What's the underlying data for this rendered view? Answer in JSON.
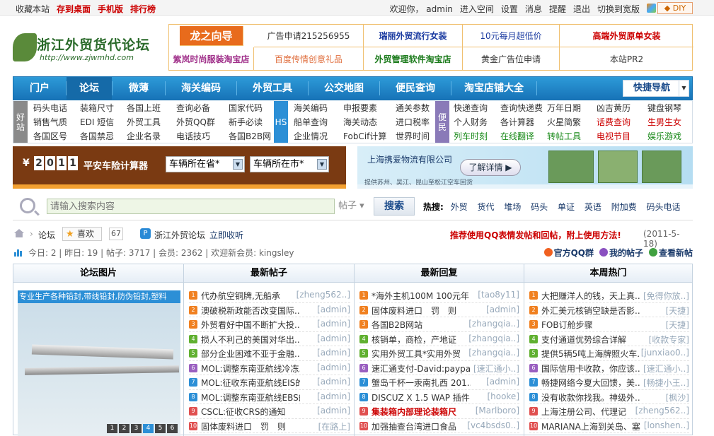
{
  "topbar": {
    "left": [
      "收藏本站",
      "存到桌面",
      "手机版",
      "排行榜"
    ],
    "greeting": "欢迎你，",
    "user": "admin",
    "right": [
      "进入空间",
      "设置",
      "消息",
      "提醒",
      "退出",
      "切换到宽版"
    ],
    "diy": "◆ DIY"
  },
  "logo": {
    "name": "浙江外贸货代论坛",
    "url": "http://www.zjwmhd.com"
  },
  "ads": [
    "龙之向导",
    "广告申请215256955",
    "瑞丽外贸流行女装",
    "10元每月超低价",
    "高端外贸原单女装",
    "紫岚时尚服装淘宝店",
    "百度传情创意礼品",
    "外贸管理软件淘宝店",
    "黄金广告位申请",
    "本站PR2"
  ],
  "nav": {
    "items": [
      "门户",
      "论坛",
      "微薄",
      "海关编码",
      "外贸工具",
      "公交地图",
      "便民查询",
      "淘宝店铺大全"
    ],
    "quick": "快捷导航"
  },
  "links": {
    "tag1": "好站",
    "tag2": "HS",
    "tag3": "便民",
    "g1": [
      [
        "码头电话",
        "销售气质",
        "各国区号"
      ],
      [
        "装箱尺寸",
        "EDI 短信",
        "各国禁忌"
      ],
      [
        "各国上班",
        "外贸工具",
        "企业名录"
      ],
      [
        "查询必备",
        "外贸QQ群",
        "电话技巧"
      ],
      [
        "国家代码",
        "新手必读",
        "各国B2B网"
      ]
    ],
    "g2": [
      [
        "海关编码",
        "船单查询",
        "企业情况"
      ],
      [
        "申报要素",
        "海关动态",
        "FobCif计算"
      ],
      [
        "通关参数",
        "进口税率",
        "世界时间"
      ]
    ],
    "g3": [
      [
        "快递查询",
        "个人财务",
        "列车时刻"
      ],
      [
        "查询快递费",
        "各计算器",
        "在线翻译"
      ],
      [
        "万年日期",
        "火星简繁",
        "转帖工具"
      ],
      [
        "凶吉黄历",
        "话费查询",
        "电视节目"
      ],
      [
        "键盘钢琴",
        "生男生女",
        "娱乐游戏"
      ]
    ]
  },
  "banner1": {
    "money": "¥",
    "digits": [
      "2",
      "0",
      "1",
      "1"
    ],
    "title": "平安车险计算器",
    "sel1": "车辆所在省*",
    "sel2": "车辆所在市*"
  },
  "banner2": {
    "company": "上海携爱物流有限公司",
    "button": "了解详情 ▶",
    "sub": "提供苏州、吴江、昆山至松江空车回货"
  },
  "search": {
    "placeholder": "请输入搜索内容",
    "type": "帖子",
    "button": "搜索",
    "hot_label": "热搜:",
    "hot": [
      "外贸",
      "货代",
      "堆场",
      "码头",
      "单证",
      "英语",
      "附加费",
      "码头电话"
    ]
  },
  "crumb": {
    "home": "论坛",
    "like": "喜欢",
    "like_count": "67",
    "forum": "浙江外贸论坛",
    "bookmark": "立即收听",
    "recommend": "推荐使用QQ表情发帖和回帖，附上使用方法!",
    "date": "(2011-5-18)"
  },
  "stats": {
    "text": "今日: 2 | 昨日: 19 | 帖子: 3717 | 会员: 2362 | 欢迎新会员: kingsley",
    "links": [
      "官方QQ群",
      "我的帖子",
      "查看新帖"
    ]
  },
  "columns": {
    "headers": [
      "论坛图片",
      "最新帖子",
      "最新回复",
      "本周热门"
    ],
    "pic_caption": "专业生产各种铅封,带线铅封,防伪铅封,塑料",
    "pager": [
      "1",
      "2",
      "3",
      "4",
      "5",
      "6"
    ],
    "latest": [
      {
        "t": "代办航空铜牌,无船承",
        "a": "[zheng562..]"
      },
      {
        "t": "澳破税新政能否改变国际..",
        "a": "[admin]"
      },
      {
        "t": "外贸看好中国不断扩大投..",
        "a": "[admin]"
      },
      {
        "t": "损人不利己的美国对华出..",
        "a": "[admin]"
      },
      {
        "t": "部分企业困难不亚于金融..",
        "a": "[admin]"
      },
      {
        "t": "MOL:调整东南亚航线冷冻..",
        "a": "[admin]"
      },
      {
        "t": "MOL:征收东南亚航线EIS的..",
        "a": "[admin]"
      },
      {
        "t": "MOL:调整东南亚航线EBS的..",
        "a": "[admin]"
      },
      {
        "t": "CSCL:征收CRS的通知",
        "a": "[admin]"
      },
      {
        "t": "固体废料进口　罚　则",
        "a": "[在路上]"
      }
    ],
    "replies": [
      {
        "t": "*海外主机100M 100元年",
        "a": "[tao8y11]"
      },
      {
        "t": "固体废料进口　罚　则",
        "a": "[admin]"
      },
      {
        "t": "各国B2B网站",
        "a": "[zhangqia..]"
      },
      {
        "t": "核销单，商检，产地证",
        "a": "[zhangqia..]"
      },
      {
        "t": "实用外贸工具*实用外贸",
        "a": "[zhangqia..]"
      },
      {
        "t": "速汇通支付-David:paypa..",
        "a": "[速汇通小..]"
      },
      {
        "t": "蟹岛千杯一汞南扎西 201..",
        "a": "[admin]"
      },
      {
        "t": "DISCUZ X 1.5 WAP 插件，..",
        "a": "[hooke]"
      },
      {
        "t": "集装箱内部理论装箱尺",
        "a": "[Marlboro]",
        "hot": true
      },
      {
        "t": "加强抽查台湾进口食品",
        "a": "[vc4bsds0..]"
      }
    ],
    "weekly": [
      {
        "t": "大把赚洋人的钱，天上真..",
        "a": "[免得你放..]"
      },
      {
        "t": "外汇美元核销空缺是否影..",
        "a": "[天捷]"
      },
      {
        "t": "FOB订舱步骤",
        "a": "[天捷]"
      },
      {
        "t": "支付通道优势综合详解",
        "a": "[收款专家]"
      },
      {
        "t": "提供5辆5吨上海牌照火车..",
        "a": "[junxiao0..]"
      },
      {
        "t": "国际信用卡收款，你应该..",
        "a": "[速汇通小..]"
      },
      {
        "t": "畅捷网络今夏大回馈，美..",
        "a": "[畅捷小王..]"
      },
      {
        "t": "没有收款你找我。神级外..",
        "a": "[枫沙]"
      },
      {
        "t": "上海注册公司、代理记",
        "a": "[zheng562..]"
      },
      {
        "t": "MARIANA上海到关岛、塞",
        "a": "[lonshen..]"
      }
    ],
    "num_colors": [
      "#f08020",
      "#f08020",
      "#f08020",
      "#60b030",
      "#60b030",
      "#9a60c0",
      "#2c8fd6",
      "#2c8fd6",
      "#e05050",
      "#e05050"
    ]
  }
}
